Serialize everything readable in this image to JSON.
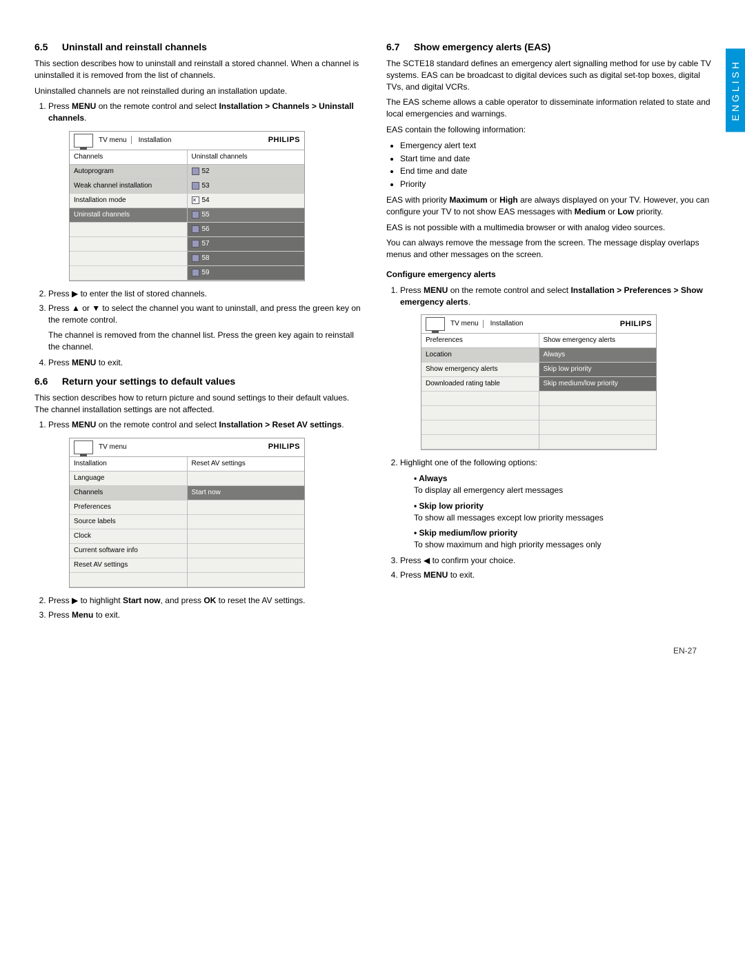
{
  "lang_tab": "ENGLISH",
  "page_number": "EN-27",
  "brand": "PHILIPS",
  "s65": {
    "num": "6.5",
    "title": "Uninstall and reinstall channels",
    "p1": "This section describes how to uninstall and reinstall a stored channel. When a channel is uninstalled it is removed from the list of channels.",
    "p2": "Uninstalled channels are not reinstalled during an installation update.",
    "step1a": "Press ",
    "step1b": "MENU",
    "step1c": " on the remote control and select ",
    "step1d": "Installation > Channels > Uninstall channels",
    "step1e": ".",
    "step2": "Press ▶ to enter the list of stored channels.",
    "step3a": "Press ▲ or ▼ to select the channel you want to uninstall, and press the green key on the remote control.",
    "step3b": "The channel is removed from the channel list. Press the green key again to reinstall the channel.",
    "step4a": "Press ",
    "step4b": "MENU",
    "step4c": " to exit.",
    "menu": {
      "crumb1": "TV menu",
      "crumb2": "Installation",
      "colhead1": "Channels",
      "colhead2": "Uninstall channels",
      "left": [
        "Autoprogram",
        "Weak channel installation",
        "Installation mode",
        "Uninstall channels"
      ],
      "right": [
        "52",
        "53",
        "54",
        "55",
        "56",
        "57",
        "58",
        "59"
      ]
    }
  },
  "s66": {
    "num": "6.6",
    "title": "Return your settings to default values",
    "p1": "This section describes how to return picture and sound settings to their default values.  The channel installation settings are not affected.",
    "step1a": "Press ",
    "step1b": "MENU",
    "step1c": " on the remote control and select ",
    "step1d": "Installation > Reset AV settings",
    "step1e": ".",
    "step2a": "Press ▶ to highlight ",
    "step2b": "Start now",
    "step2c": ", and press ",
    "step2d": "OK",
    "step2e": " to reset the AV settings.",
    "step3a": "Press ",
    "step3b": "Menu",
    "step3c": " to exit.",
    "menu": {
      "crumb1": "TV menu",
      "colhead1": "Installation",
      "colhead2": "Reset AV settings",
      "left": [
        "Language",
        "Channels",
        "Preferences",
        "Source labels",
        "Clock",
        "Current software info",
        "Reset AV settings"
      ],
      "right_hl": "Start now"
    }
  },
  "s67": {
    "num": "6.7",
    "title": "Show emergency alerts (EAS)",
    "p1": "The SCTE18 standard defines an emergency alert signalling method for use by cable TV systems.  EAS can be broadcast to digital devices such as digital set-top boxes, digital TVs, and digital VCRs.",
    "p2": "The EAS scheme allows a cable operator to disseminate information related to state and local emergencies and warnings.",
    "p3": "EAS contain the following information:",
    "bullets": [
      "Emergency alert text",
      "Start time and date",
      "End time and date",
      "Priority"
    ],
    "p4a": "EAS with priority ",
    "p4b": "Maximum",
    "p4c": " or ",
    "p4d": "High",
    "p4e": " are always displayed on your TV. However, you can configure your TV to not show EAS messages with ",
    "p4f": "Medium",
    "p4g": " or ",
    "p4h": "Low",
    "p4i": " priority.",
    "p5": "EAS is not possible with a multimedia browser or with analog video sources.",
    "p6": "You can always remove the message from the screen.  The message display overlaps menus and other messages on the screen.",
    "conf_head": "Configure emergency alerts",
    "step1a": "Press ",
    "step1b": "MENU",
    "step1c": " on the remote control and select ",
    "step1d": "Installation > Preferences > Show emergency alerts",
    "step1e": ".",
    "step2": "Highlight one of the following options:",
    "opts": {
      "o1": "Always",
      "o1d": "To display all emergency alert messages",
      "o2": "Skip low priority",
      "o2d": "To show all messages except low priority messages",
      "o3": "Skip medium/low priority",
      "o3d": "To show maximum and high priority messages only"
    },
    "step3": "Press ◀ to confirm your choice.",
    "step4a": "Press ",
    "step4b": "MENU",
    "step4c": " to exit.",
    "menu": {
      "crumb1": "TV menu",
      "crumb2": "Installation",
      "colhead1": "Preferences",
      "colhead2": "Show emergency alerts",
      "left": [
        "Location",
        "Show emergency alerts",
        "Downloaded rating table"
      ],
      "right": [
        "Always",
        "Skip low priority",
        "Skip medium/low priority"
      ]
    }
  }
}
